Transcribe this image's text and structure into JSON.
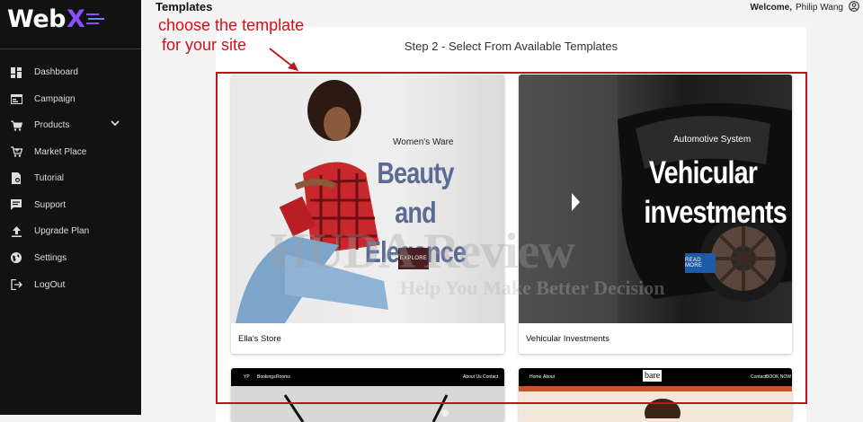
{
  "brand": {
    "name_prefix": "Web",
    "name_suffix": "X"
  },
  "sidebar": {
    "items": [
      {
        "label": "Dashboard",
        "icon": "dashboard-icon"
      },
      {
        "label": "Campaign",
        "icon": "campaign-icon"
      },
      {
        "label": "Products",
        "icon": "cart-icon",
        "has_dropdown": true
      },
      {
        "label": "Market Place",
        "icon": "market-cart-icon"
      },
      {
        "label": "Tutorial",
        "icon": "tutorial-icon"
      },
      {
        "label": "Support",
        "icon": "chat-icon"
      },
      {
        "label": "Upgrade Plan",
        "icon": "upload-icon"
      },
      {
        "label": "Settings",
        "icon": "globe-icon"
      },
      {
        "label": "LogOut",
        "icon": "logout-icon"
      }
    ]
  },
  "header": {
    "title": "Templates",
    "welcome_label": "Welcome,",
    "user_name": "Philip Wang"
  },
  "annotation": {
    "line1": "choose the template",
    "line2": "for your site",
    "color": "#d0121b"
  },
  "main": {
    "step_title": "Step 2 - Select From Available Templates",
    "templates": [
      {
        "name": "Ella's Store",
        "hero_sub": "Women's Ware",
        "hero_title_1": "Beauty and",
        "hero_title_2": "Elegance",
        "hero_button": "EXPLORE",
        "title_color": "#5b6b94",
        "button_color": "#4a1f22"
      },
      {
        "name": "Vehicular Investments",
        "hero_sub": "Automotive System",
        "hero_title_1": "Vehicular",
        "hero_title_2": "investments",
        "hero_button": "READ MORE",
        "title_color": "#ffffff",
        "button_color": "#1f5aa8"
      },
      {
        "nav_links": [
          "YP",
          "Bookings",
          "Rooms",
          "About Us",
          "Contact"
        ]
      },
      {
        "logo": "bare",
        "nav_links": [
          "Home",
          "About",
          "Contact",
          "BOOK NOW"
        ]
      }
    ]
  },
  "watermark": {
    "line1": "HUDA Review",
    "line2": "Help You Make Better Decision"
  }
}
